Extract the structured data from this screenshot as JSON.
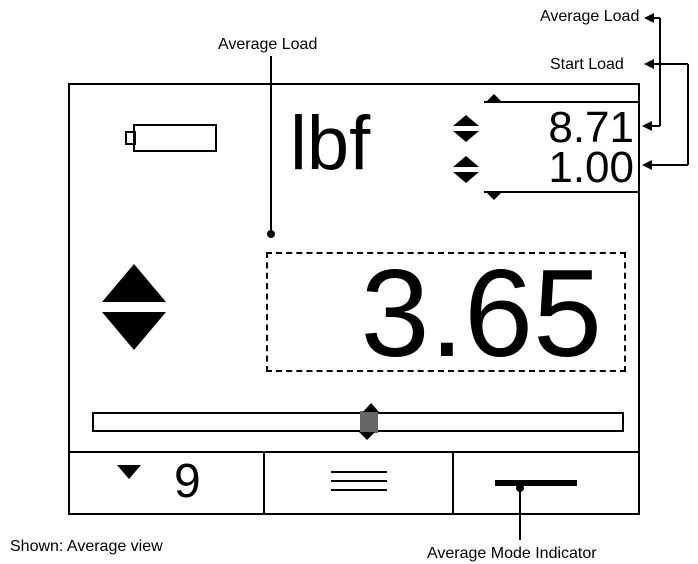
{
  "callouts": {
    "average_load_top_right": "Average Load",
    "start_load": "Start Load",
    "average_load_center": "Average Load",
    "shown": "Shown: Average view",
    "mode_indicator": "Average Mode Indicator"
  },
  "display": {
    "unit": "lbf",
    "average_load_value": "8.71",
    "start_load_value": "1.00",
    "main_reading": "3.65",
    "bottom_left_count": "9"
  },
  "slider": {
    "position_fraction": 0.52
  },
  "colors": {
    "ink": "#000000",
    "slider_thumb": "#666666",
    "background": "#ffffff"
  },
  "icons": [
    "battery-icon",
    "up-down-arrows-icon",
    "menu-lines-icon",
    "minus-bar-icon",
    "triangle-down-icon"
  ]
}
